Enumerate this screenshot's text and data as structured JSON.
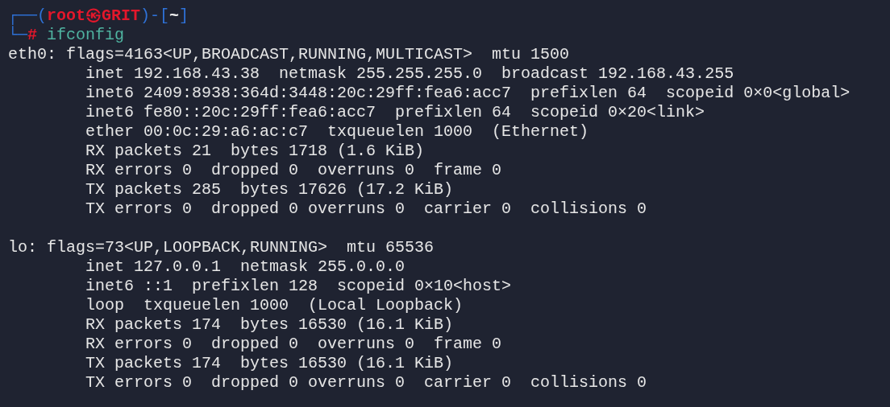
{
  "prompt": [
    {
      "segments": [
        {
          "text": "┌──(",
          "kind": "frame"
        },
        {
          "text": "root㉿GRIT",
          "kind": "user"
        },
        {
          "text": ")-[",
          "kind": "frame"
        },
        {
          "text": "~",
          "kind": "cwd"
        },
        {
          "text": "]",
          "kind": "frame"
        }
      ]
    },
    {
      "segments": [
        {
          "text": "└─",
          "kind": "frame"
        },
        {
          "text": "#",
          "kind": "symbol"
        },
        {
          "text": " ifconfig",
          "kind": "command"
        }
      ]
    }
  ],
  "interfaces": [
    {
      "header": "eth0: flags=4163<UP,BROADCAST,RUNNING,MULTICAST>  mtu 1500",
      "lines": [
        "inet 192.168.43.38  netmask 255.255.255.0  broadcast 192.168.43.255",
        "inet6 2409:8938:364d:3448:20c:29ff:fea6:acc7  prefixlen 64  scopeid 0×0<global>",
        "inet6 fe80::20c:29ff:fea6:acc7  prefixlen 64  scopeid 0×20<link>",
        "ether 00:0c:29:a6:ac:c7  txqueuelen 1000  (Ethernet)",
        "RX packets 21  bytes 1718 (1.6 KiB)",
        "RX errors 0  dropped 0  overruns 0  frame 0",
        "TX packets 285  bytes 17626 (17.2 KiB)",
        "TX errors 0  dropped 0 overruns 0  carrier 0  collisions 0"
      ]
    },
    {
      "header": "lo: flags=73<UP,LOOPBACK,RUNNING>  mtu 65536",
      "lines": [
        "inet 127.0.0.1  netmask 255.0.0.0",
        "inet6 ::1  prefixlen 128  scopeid 0×10<host>",
        "loop  txqueuelen 1000  (Local Loopback)",
        "RX packets 174  bytes 16530 (16.1 KiB)",
        "RX errors 0  dropped 0  overruns 0  frame 0",
        "TX packets 174  bytes 16530 (16.1 KiB)",
        "TX errors 0  dropped 0 overruns 0  carrier 0  collisions 0"
      ]
    }
  ]
}
